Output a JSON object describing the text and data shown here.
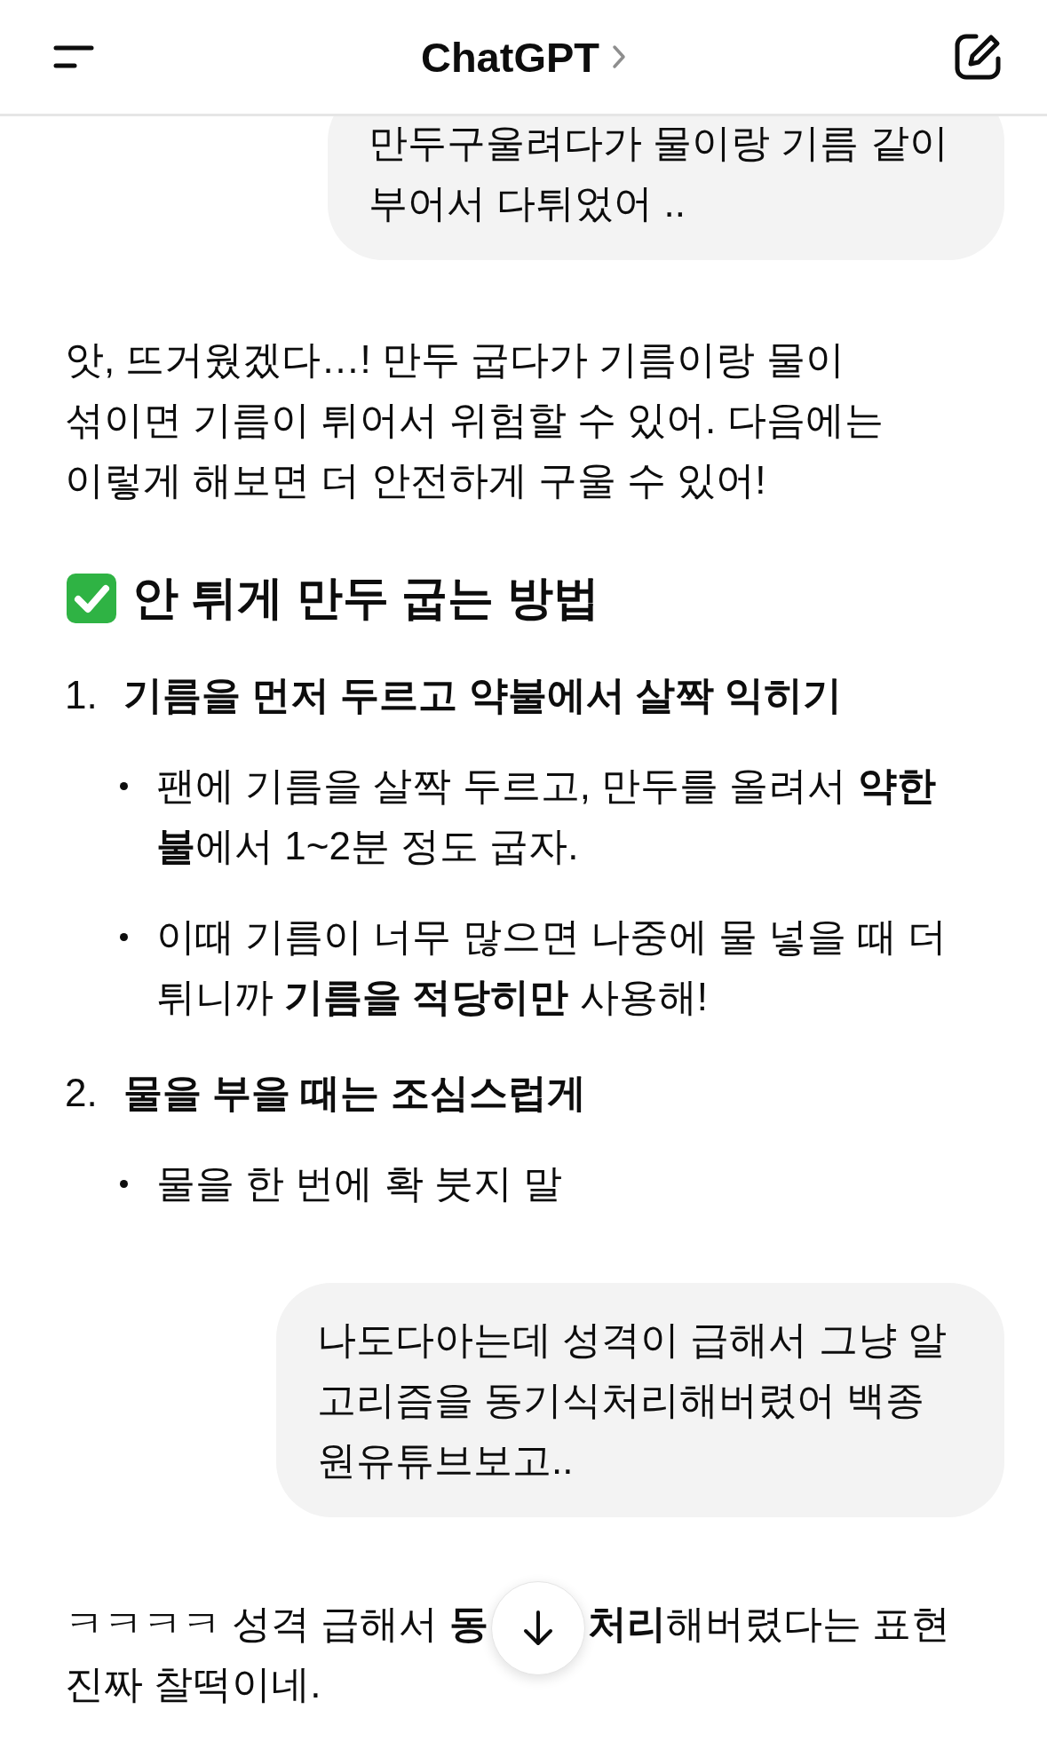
{
  "header": {
    "title": "ChatGPT"
  },
  "messages": [
    {
      "kind": "user",
      "text": "만두구울려다가 물이랑 기름 같이 부어서 다튀었어 .."
    },
    {
      "kind": "assistant",
      "blocks": [
        {
          "kind": "paragraph",
          "text": "앗, 뜨거웠겠다…! 만두 굽다가 기름이랑 물이 섞이면 기름이 튀어서 위험할 수 있어. 다음에는 이렇게 해보면 더 안전하게 구울 수 있어!"
        },
        {
          "kind": "heading",
          "text": "안 튀게 만두 굽는 방법"
        },
        {
          "kind": "numbered",
          "number": "1.",
          "text": "기름을 먼저 두르고 약불에서 살짝 익히기",
          "bullets": [
            "팬에 기름을 살짝 두르고, 만두를 올려서 **약한 불**에서 1~2분 정도 굽자.",
            "이때 기름이 너무 많으면 나중에 물 넣을 때 더 튀니까 **기름을 적당히만** 사용해!"
          ]
        },
        {
          "kind": "numbered",
          "number": "2.",
          "text": "물을 부을 때는 조심스럽게",
          "bullets": [
            "물을 한 번에 확 붓지 말"
          ]
        }
      ]
    },
    {
      "kind": "user",
      "text": "나도다아는데 성격이 급해서 그냥 알고리즘을 동기식처리해버렸어 백종원유튜브보고.."
    },
    {
      "kind": "assistant",
      "blocks": [
        {
          "kind": "covered_paragraph",
          "fragments": [
            "ㅋㅋㅋㅋ 성격 급해서 **동**",
            "**처리**해버렸다는 표현",
            "진짜 찰떡이네."
          ]
        }
      ]
    }
  ]
}
